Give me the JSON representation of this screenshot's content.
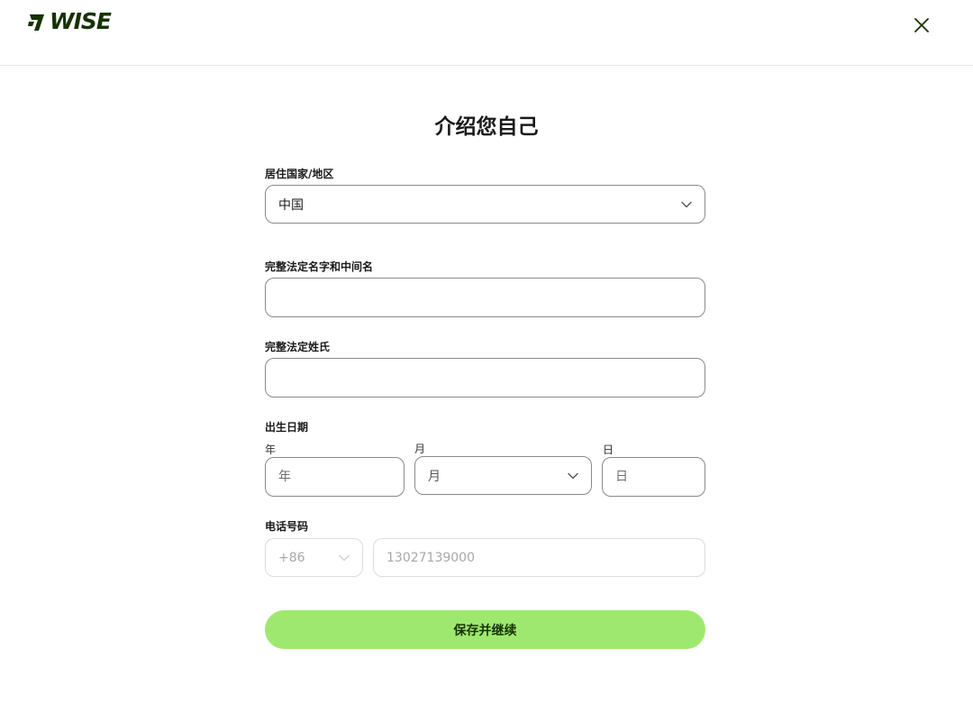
{
  "header": {
    "logo_text": "WISE",
    "brand_color": "#163300"
  },
  "page": {
    "title": "介绍您自己"
  },
  "form": {
    "country": {
      "label": "居住国家/地区",
      "value": "中国"
    },
    "first_name": {
      "label": "完整法定名字和中间名",
      "value": ""
    },
    "last_name": {
      "label": "完整法定姓氏",
      "value": ""
    },
    "dob": {
      "label": "出生日期",
      "year": {
        "label": "年",
        "placeholder": "年"
      },
      "month": {
        "label": "月",
        "placeholder": "月"
      },
      "day": {
        "label": "日",
        "placeholder": "日"
      }
    },
    "phone": {
      "label": "电话号码",
      "country_code": "+86",
      "number_placeholder": "13027139000"
    },
    "submit_label": "保存并继续"
  },
  "colors": {
    "accent": "#9fe870",
    "border": "#8a8a8a",
    "border_disabled": "#dcdcdc"
  }
}
